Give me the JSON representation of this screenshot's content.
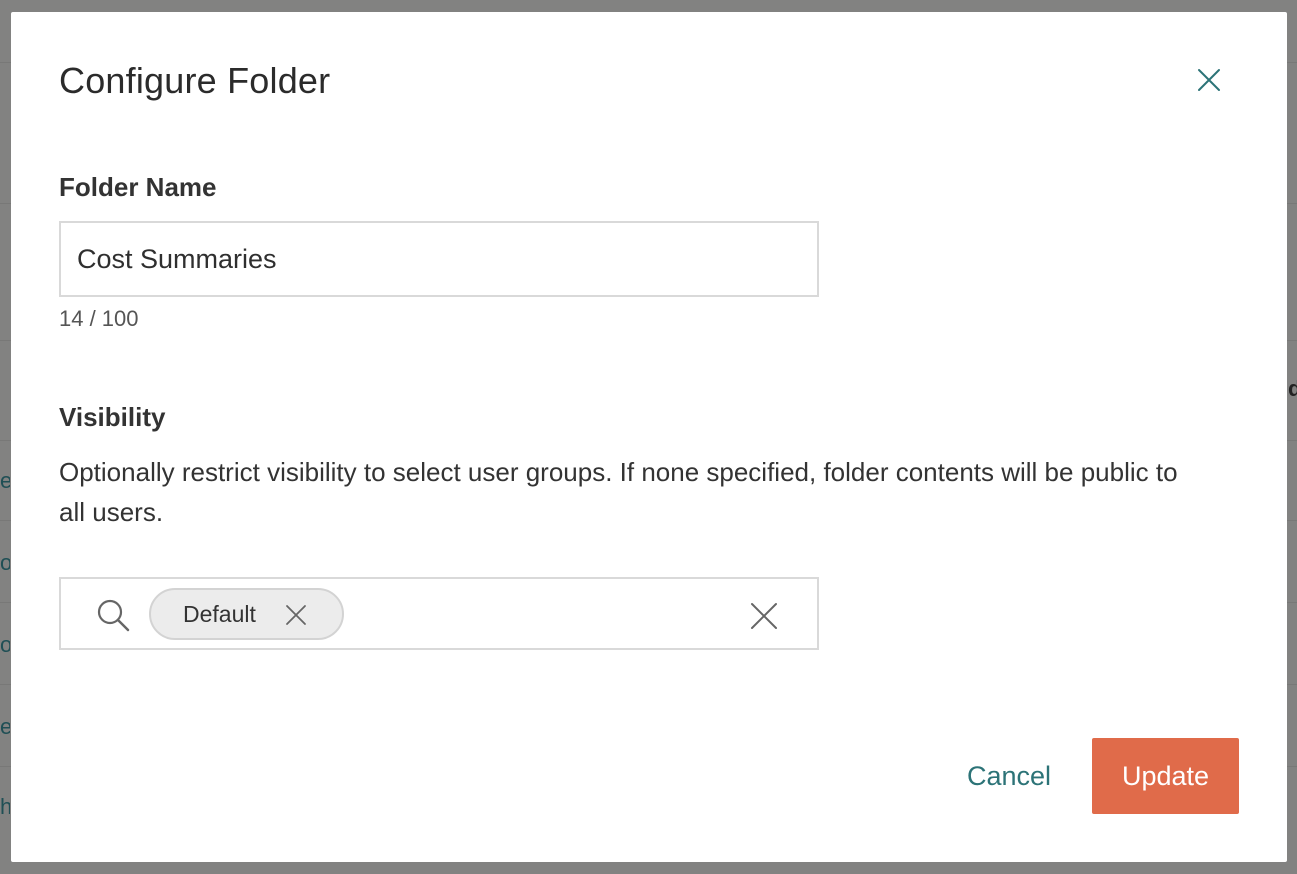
{
  "dialog": {
    "title": "Configure Folder",
    "close_icon": "close-icon"
  },
  "folder_name": {
    "label": "Folder Name",
    "value": "Cost Summaries",
    "char_count": "14 / 100"
  },
  "visibility": {
    "label": "Visibility",
    "help_text": "Optionally restrict visibility to select user groups. If none specified, folder contents will be public to all users.",
    "search_icon": "search-icon",
    "selected_groups": [
      "Default"
    ],
    "clear_icon": "close-icon"
  },
  "actions": {
    "cancel_label": "Cancel",
    "update_label": "Update"
  },
  "background_fragments": {
    "right_1": "d",
    "left_1": "es",
    "left_2": "o",
    "left_3": "o",
    "left_4": "e",
    "left_5": "h"
  },
  "colors": {
    "accent": "#2c7377",
    "primary_button": "#e06b4a",
    "overlay": "#7f7f7e"
  }
}
